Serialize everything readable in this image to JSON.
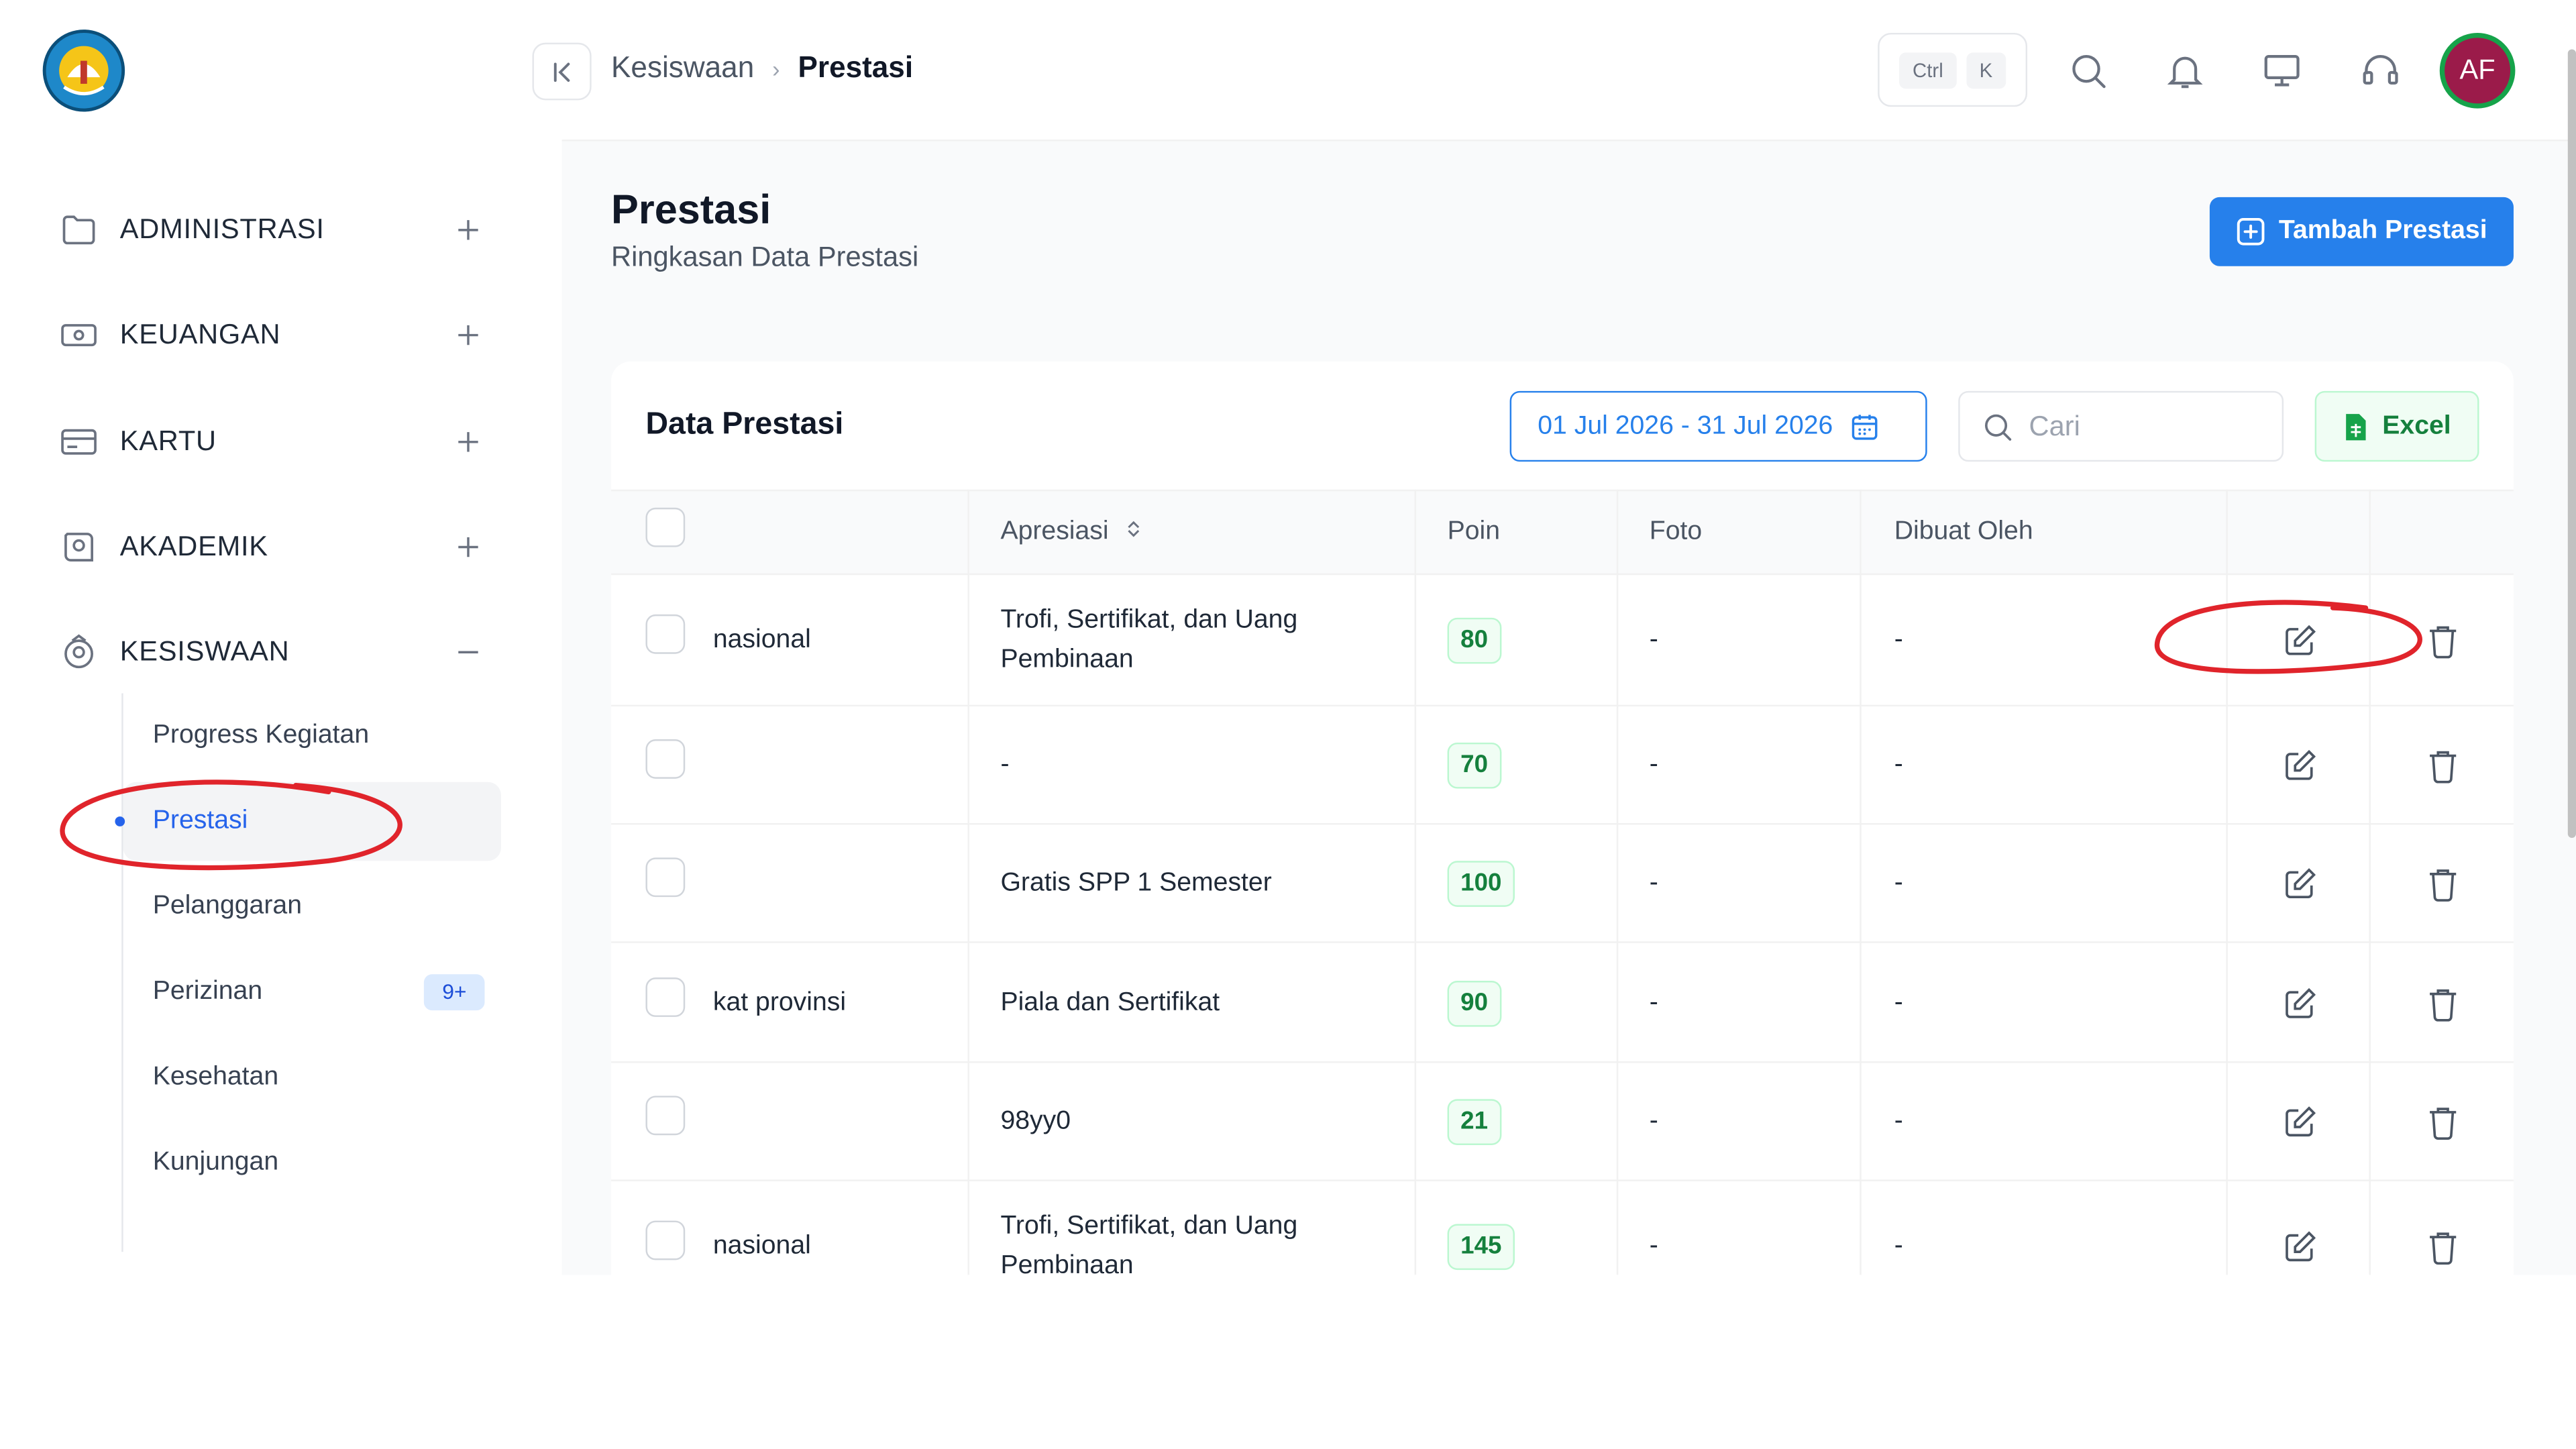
{
  "header": {
    "breadcrumb": [
      "Kesiswaan",
      "Prestasi"
    ],
    "shortcut_keys": [
      "Ctrl",
      "K"
    ],
    "avatar_initials": "AF",
    "avatar_color": "#9b1b4a"
  },
  "sidebar": {
    "groups": [
      {
        "label": "ADMINISTRASI",
        "icon": "folder-icon",
        "state": "+"
      },
      {
        "label": "KEUANGAN",
        "icon": "money-icon",
        "state": "+"
      },
      {
        "label": "KARTU",
        "icon": "card-icon",
        "state": "+"
      },
      {
        "label": "AKADEMIK",
        "icon": "academic-icon",
        "state": "+"
      },
      {
        "label": "KESISWAAN",
        "icon": "student-icon",
        "state": "−"
      }
    ],
    "sub_items": [
      {
        "label": "Progress Kegiatan"
      },
      {
        "label": "Prestasi",
        "active": true
      },
      {
        "label": "Pelanggaran"
      },
      {
        "label": "Perizinan",
        "badge": "9+"
      },
      {
        "label": "Kesehatan"
      },
      {
        "label": "Kunjungan"
      }
    ]
  },
  "page": {
    "title": "Prestasi",
    "subtitle": "Ringkasan Data Prestasi",
    "add_button": "Tambah Prestasi"
  },
  "card": {
    "title": "Data Prestasi",
    "date_range": "01 Jul 2026 - 31 Jul 2026",
    "search_placeholder": "Cari",
    "excel_label": "Excel",
    "columns": [
      "Apresiasi",
      "Poin",
      "Foto",
      "Dibuat Oleh"
    ],
    "rows": [
      {
        "name": "nasional",
        "apresiasi": "Trofi, Sertifikat, dan Uang Pembinaan",
        "poin": "80",
        "foto": "-",
        "dibuat_oleh": "-"
      },
      {
        "name": "",
        "apresiasi": "-",
        "poin": "70",
        "foto": "-",
        "dibuat_oleh": "-"
      },
      {
        "name": "",
        "apresiasi": "Gratis SPP 1 Semester",
        "poin": "100",
        "foto": "-",
        "dibuat_oleh": "-"
      },
      {
        "name": "kat provinsi",
        "apresiasi": "Piala dan Sertifikat",
        "poin": "90",
        "foto": "-",
        "dibuat_oleh": "-"
      },
      {
        "name": "",
        "apresiasi": "98yy0",
        "poin": "21",
        "foto": "-",
        "dibuat_oleh": "-"
      },
      {
        "name": "nasional",
        "apresiasi": "Trofi, Sertifikat, dan Uang Pembinaan",
        "poin": "145",
        "foto": "-",
        "dibuat_oleh": "-"
      }
    ]
  },
  "colors": {
    "primary": "#2680eb",
    "success": "#15803d",
    "annotation": "#e0242b"
  }
}
